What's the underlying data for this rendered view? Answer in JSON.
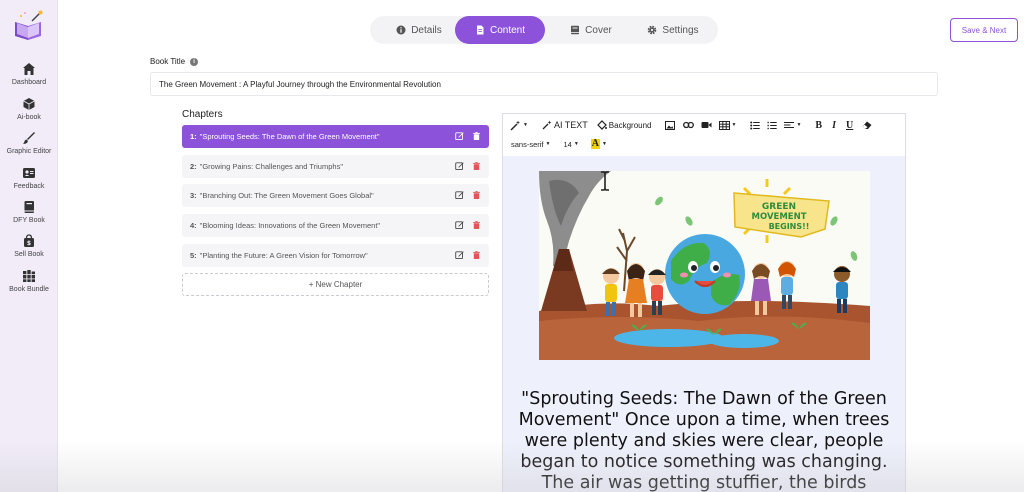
{
  "sidebar": {
    "items": [
      {
        "label": "Dashboard",
        "icon": "home-icon"
      },
      {
        "label": "Ai-book",
        "icon": "ai-book-icon"
      },
      {
        "label": "Graphic Editor",
        "icon": "brush-icon"
      },
      {
        "label": "Feedback",
        "icon": "feedback-icon"
      },
      {
        "label": "DFY Book",
        "icon": "book-icon"
      },
      {
        "label": "Sell Book",
        "icon": "bag-icon"
      },
      {
        "label": "Book Bundle",
        "icon": "bundle-icon"
      }
    ]
  },
  "tabs": [
    {
      "label": "Details",
      "icon": "info-icon"
    },
    {
      "label": "Content",
      "icon": "file-icon",
      "active": true
    },
    {
      "label": "Cover",
      "icon": "cover-icon"
    },
    {
      "label": "Settings",
      "icon": "gear-icon"
    }
  ],
  "save_button": "Save & Next",
  "book_title": {
    "label": "Book Title",
    "value": "The Green Movement : A Playful Journey through the Environmental Revolution"
  },
  "chapters": {
    "heading": "Chapters",
    "items": [
      {
        "num": "1:",
        "title": "\"Sprouting Seeds: The Dawn of the Green Movement\"",
        "active": true
      },
      {
        "num": "2:",
        "title": "\"Growing Pains: Challenges and Triumphs\""
      },
      {
        "num": "3:",
        "title": "\"Branching Out: The Green Movement Goes Global\""
      },
      {
        "num": "4:",
        "title": "\"Blooming Ideas: Innovations of the Green Movement\""
      },
      {
        "num": "5:",
        "title": "\"Planting the Future: A Green Vision for Tomorrow\""
      }
    ],
    "new_label": "+ New Chapter"
  },
  "toolbar": {
    "ai_text": "AI TEXT",
    "background": "Background",
    "font_family": "sans-serif",
    "font_size": "14",
    "bold": "B",
    "italic": "I",
    "underline": "U",
    "font_color_glyph": "A"
  },
  "illustration": {
    "banner_line1": "GREEN",
    "banner_line2": "MOVEMENT",
    "banner_line3": "BEGINS!!"
  },
  "story_text": "\"Sprouting Seeds: The Dawn of the Green Movement\" Once upon a time, when trees were plenty and skies were clear, people began to notice something was changing. The air was getting stuffier, the birds",
  "colors": {
    "accent": "#8c52d9",
    "sidebar_bg": "#f1ecf8",
    "delete_red": "#e05555"
  }
}
